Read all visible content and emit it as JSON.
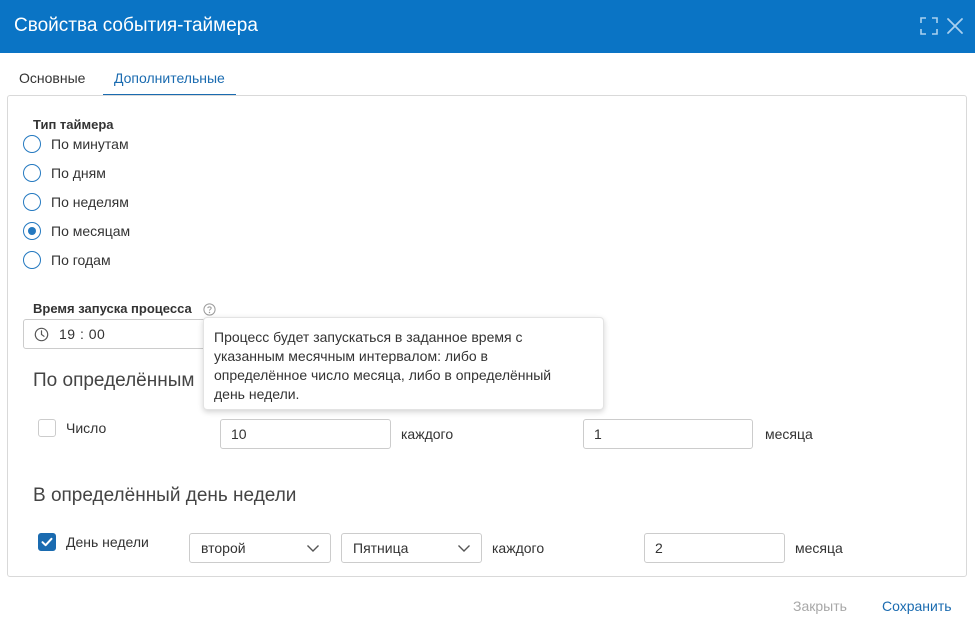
{
  "window": {
    "title": "Свойства события-таймера",
    "expand_icon": "expand-icon",
    "close_icon": "close-icon",
    "header_color": "#0a74c5"
  },
  "tabs": [
    {
      "label": "Основные",
      "active": false
    },
    {
      "label": "Дополнительные",
      "active": true
    }
  ],
  "timer_type": {
    "label": "Тип таймера",
    "options": [
      {
        "label": "По минутам",
        "selected": false
      },
      {
        "label": "По дням",
        "selected": false
      },
      {
        "label": "По неделям",
        "selected": false
      },
      {
        "label": "По месяцам",
        "selected": true
      },
      {
        "label": "По годам",
        "selected": false
      }
    ]
  },
  "start_time": {
    "label": "Время запуска процесса",
    "help_icon": "question-circle-icon",
    "clock_icon": "clock-icon",
    "value": "19 : 00"
  },
  "tooltip": {
    "lines": [
      "Процесс будет запускаться в заданное время с",
      "указанным месячным интервалом: либо в",
      "определённое число месяца, либо в определённый",
      "день недели."
    ]
  },
  "by_date": {
    "title": "По определённым",
    "checkbox_label": "Число",
    "checked": false,
    "day_value": "10",
    "every_label": "каждого",
    "month_value": "1",
    "month_label": "месяца"
  },
  "by_weekday": {
    "title": "В определённый день недели",
    "checkbox_label": "День недели",
    "checked": true,
    "ordinal_select": "второй",
    "weekday_select": "Пятница",
    "every_label": "каждого",
    "month_value": "2",
    "month_label": "месяца"
  },
  "footer": {
    "close_label": "Закрыть",
    "save_label": "Сохранить"
  },
  "colors": {
    "accent": "#1a6bb0",
    "radio": "#2479c0",
    "disabled_text": "#a8a8a8"
  }
}
